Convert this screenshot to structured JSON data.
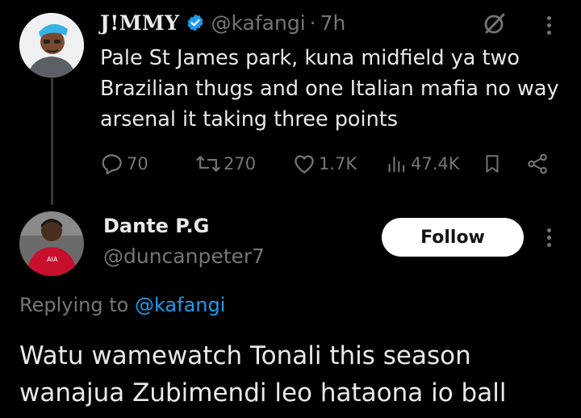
{
  "tweet": {
    "author_name": "J!MMY",
    "handle": "@kafangi",
    "separator": "·",
    "time": "7h",
    "text": "Pale St James park, kuna midfield ya two Brazilian thugs and one Italian mafia no way arsenal it taking three points",
    "actions": {
      "replies": "70",
      "retweets": "270",
      "likes": "1.7K",
      "views": "47.4K"
    }
  },
  "reply": {
    "author_name": "Dante P.G",
    "handle": "@duncanpeter7",
    "follow_label": "Follow",
    "replying_prefix": "Replying to",
    "replying_handle": "@kafangi",
    "text": "Watu wamewatch Tonali this season wanajua Zubimendi leo hataona io ball"
  },
  "colors": {
    "background": "#000000",
    "text": "#e7e9ea",
    "muted": "#71767b",
    "link": "#1d9bf0",
    "verified": "#1d9bf0"
  },
  "icons": [
    "reply-icon",
    "retweet-icon",
    "like-icon",
    "views-icon",
    "bookmark-icon",
    "share-icon",
    "grok-icon",
    "more-icon",
    "verified-badge-icon"
  ]
}
